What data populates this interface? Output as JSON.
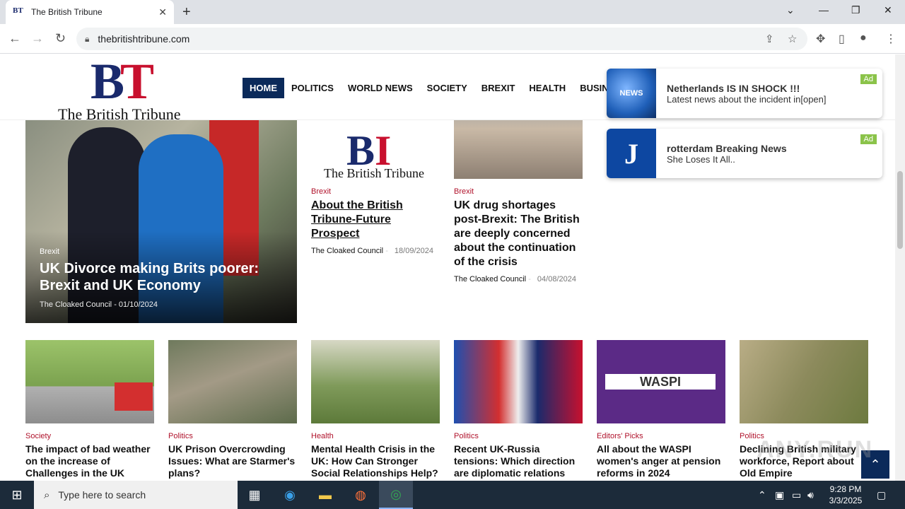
{
  "browser": {
    "tab_title": "The British Tribune",
    "favicon_text": "BT",
    "url": "thebritishtribune.com"
  },
  "site": {
    "logo_letters": "BT",
    "logo_name": "The British Tribune",
    "nav": [
      {
        "label": "HOME",
        "active": true
      },
      {
        "label": "POLITICS"
      },
      {
        "label": "WORLD NEWS"
      },
      {
        "label": "SOCIETY"
      },
      {
        "label": "BREXIT"
      },
      {
        "label": "HEALTH"
      },
      {
        "label": "BUSINESS"
      }
    ]
  },
  "ads": [
    {
      "title": "Netherlands IS IN SHOCK !!!",
      "subtitle": "Latest news about the incident in[open]",
      "badge": "Ad",
      "thumb_text": "NEWS"
    },
    {
      "title": "rotterdam Breaking News",
      "subtitle": "She Loses It All..",
      "badge": "Ad",
      "thumb_text": "J"
    }
  ],
  "hero": {
    "category": "Brexit",
    "title": "UK Divorce making Brits poorer: Brexit and UK Economy",
    "author": "The Cloaked Council",
    "separator": "-",
    "date": "01/10/2024"
  },
  "top_cards": [
    {
      "category": "Brexit",
      "title": "About the British Tribune-Future Prospect",
      "author": "The Cloaked Council",
      "date": "18/09/2024",
      "img_text": "The British Tribune"
    },
    {
      "category": "Brexit",
      "title": "UK drug shortages post-Brexit: The British are deeply concerned about the continuation of the crisis",
      "author": "The Cloaked Council",
      "date": "04/08/2024"
    }
  ],
  "bottom_cards": [
    {
      "category": "Society",
      "title": "The impact of bad weather on the increase of Challenges in the UK"
    },
    {
      "category": "Politics",
      "title": "UK Prison Overcrowding Issues: What are Starmer's plans?"
    },
    {
      "category": "Health",
      "title": "Mental Health Crisis in the UK: How Can Stronger Social Relationships Help?"
    },
    {
      "category": "Politics",
      "title": "Recent UK-Russia tensions: Which direction are diplomatic relations"
    },
    {
      "category": "Editors' Picks",
      "title": "All about the WASPI women's anger at pension reforms in 2024",
      "img_text": "WASPI"
    },
    {
      "category": "Politics",
      "title": "Declining British military workforce, Report about Old Empire"
    }
  ],
  "taskbar": {
    "search_placeholder": "Type here to search",
    "time": "9:28 PM",
    "date": "3/3/2025"
  },
  "watermark": "ANY.RUN"
}
